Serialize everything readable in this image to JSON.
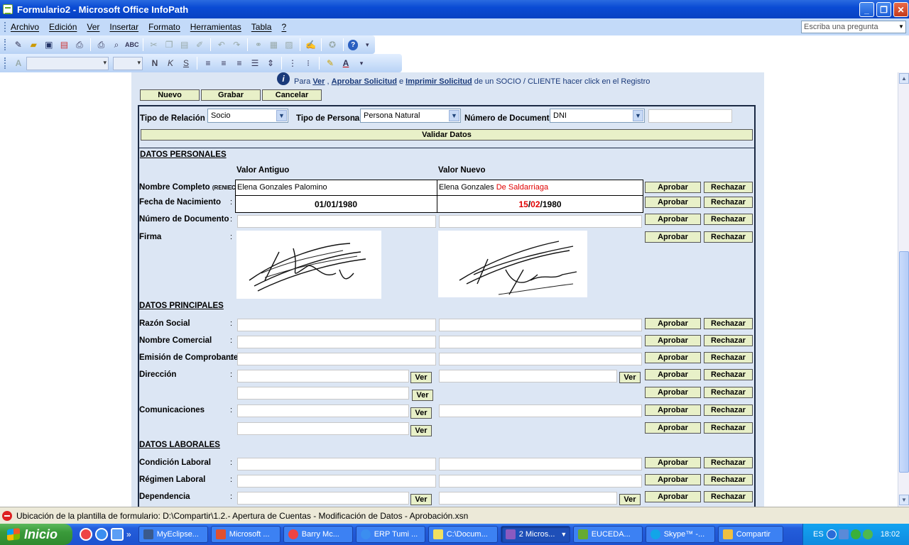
{
  "window": {
    "title": "Formulario2 - Microsoft Office InfoPath"
  },
  "menu": {
    "items": [
      "Archivo",
      "Edición",
      "Ver",
      "Insertar",
      "Formato",
      "Herramientas",
      "Tabla",
      "?"
    ],
    "ask_placeholder": "Escriba una pregunta"
  },
  "toolbar_icons": {
    "standard": [
      "design-icon",
      "open-icon",
      "save-icon",
      "export-pdf-icon",
      "print-preview-icon",
      "print-icon",
      "preview-icon",
      "spellcheck-icon",
      "cut-icon",
      "copy-icon",
      "paste-icon",
      "format-painter-icon",
      "undo-icon",
      "redo-icon",
      "hyperlink-icon",
      "table-icon",
      "picture-icon",
      "sign-icon",
      "digital-signature-icon",
      "help-icon"
    ],
    "format": [
      "bold",
      "italic",
      "underline",
      "align-left",
      "align-center",
      "align-right",
      "justify",
      "line-spacing",
      "numbered-list",
      "bulleted-list",
      "highlight",
      "font-color"
    ],
    "format_labels": {
      "bold": "N",
      "italic": "K",
      "underline": "S"
    }
  },
  "form": {
    "hint": {
      "prefix": "Para",
      "link_ver": "Ver",
      "sep1": ",",
      "link_aprobar": "Aprobar Solicitud",
      "sep2": "e",
      "link_imprimir": "Imprimir Solicitud",
      "suffix": "de un SOCIO / CLIENTE hacer click en el Registro"
    },
    "actions": {
      "nuevo": "Nuevo",
      "grabar": "Grabar",
      "cancelar": "Cancelar"
    },
    "search": {
      "tipo_relacion_label": "Tipo de Relación",
      "tipo_relacion_value": "Socio",
      "tipo_persona_label": "Tipo de Persona",
      "tipo_persona_value": "Persona Natural",
      "numero_documento_label": "Número de Documento",
      "numero_documento_value": "DNI",
      "validar_label": "Validar Datos"
    },
    "colon": ":",
    "columns": {
      "old": "Valor Antiguo",
      "new": "Valor Nuevo"
    },
    "buttons": {
      "aprobar": "Aprobar",
      "rechazar": "Rechazar",
      "ver": "Ver"
    },
    "sections": {
      "personales": "DATOS PERSONALES",
      "principales": "DATOS PRINCIPALES",
      "laborales": "DATOS LABORALES"
    },
    "personales": {
      "nombre_label": "Nombre Completo",
      "nombre_label_small": "(RENIEC)",
      "nombre_old": "Elena Gonzales Palomino",
      "nombre_new_a": "Elena Gonzales",
      "nombre_new_b": "De Saldarriaga",
      "fecha_label": "Fecha de Nacimiento",
      "fecha_old": "01/01/1980",
      "fecha_new_d": "15",
      "fecha_new_s1": "/",
      "fecha_new_m": "02",
      "fecha_new_y": "/1980",
      "numdoc_label": "Número de Documento",
      "firma_label": "Firma"
    },
    "principales": {
      "razon_social": "Razón Social",
      "nombre_comercial": "Nombre Comercial",
      "emision": "Emisión de Comprobantes",
      "direccion": "Dirección",
      "comunicaciones": "Comunicaciones"
    },
    "laborales": {
      "condicion": "Condición Laboral",
      "regimen": "Régimen Laboral",
      "dependencia": "Dependencia"
    }
  },
  "status": {
    "text": "Ubicación de la plantilla de formulario: D:\\Compartir\\1.2.- Apertura de Cuentas - Modificación de Datos - Aprobación.xsn"
  },
  "taskbar": {
    "start": "Inicio",
    "overflow": "»",
    "tasks": [
      "MyEclipse...",
      "Microsoft ...",
      "Barry Mc...",
      "ERP Tumi ...",
      "C:\\Docum...",
      "2 Micros...",
      "EUCEDA...",
      "Skype™ -...",
      "Compartir"
    ],
    "lang": "ES",
    "clock": "18:02"
  },
  "colors": {
    "title_bar": "#0a4bd4",
    "form_bg": "#dce6f4",
    "button_bg": "#e8f0c8",
    "changed_text": "#e00000",
    "start_button": "#3a9a3a"
  }
}
